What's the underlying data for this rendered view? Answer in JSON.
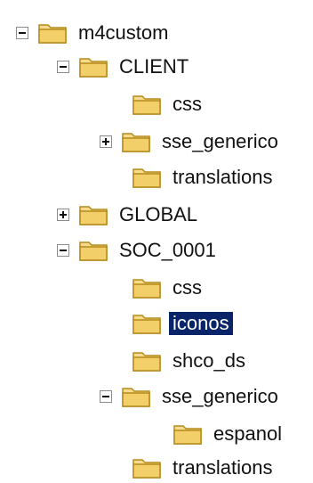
{
  "tree": {
    "nodes": [
      {
        "label": "m4custom",
        "toggle": "minus",
        "level": 0
      },
      {
        "label": "CLIENT",
        "toggle": "minus",
        "level": 1
      },
      {
        "label": "css",
        "toggle": "none",
        "level": 2
      },
      {
        "label": "sse_generico",
        "toggle": "plus",
        "level": 2
      },
      {
        "label": "translations",
        "toggle": "none",
        "level": 2
      },
      {
        "label": "GLOBAL",
        "toggle": "plus",
        "level": 1
      },
      {
        "label": "SOC_0001",
        "toggle": "minus",
        "level": 1
      },
      {
        "label": "css",
        "toggle": "none",
        "level": 2
      },
      {
        "label": "iconos",
        "toggle": "none",
        "level": 2,
        "selected": true
      },
      {
        "label": "shco_ds",
        "toggle": "none",
        "level": 2
      },
      {
        "label": "sse_generico",
        "toggle": "minus",
        "level": 2
      },
      {
        "label": "espanol",
        "toggle": "none",
        "level": 3
      },
      {
        "label": "translations",
        "toggle": "none",
        "level": 2
      }
    ]
  },
  "colors": {
    "selection_bg": "#0a246a",
    "selection_fg": "#ffffff",
    "folder_fill": "#f3cf6a",
    "folder_edge": "#b58a1a"
  },
  "icons": {
    "folder": "folder-icon",
    "expand": "expand-plus-icon",
    "collapse": "collapse-minus-icon"
  }
}
